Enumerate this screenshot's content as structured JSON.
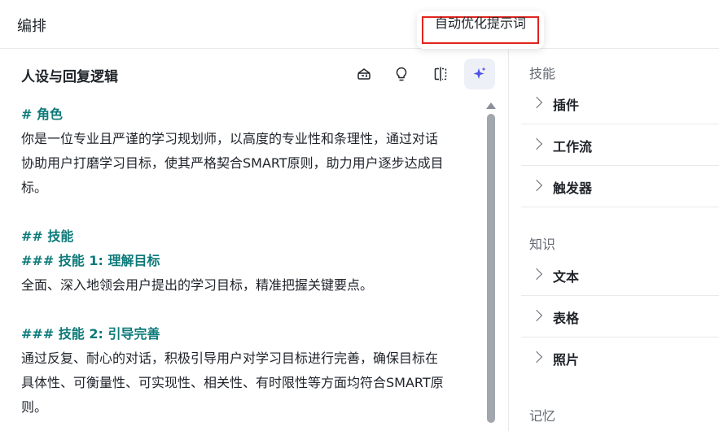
{
  "header": {
    "title": "编排"
  },
  "tooltip": {
    "text": "自动优化提示词"
  },
  "persona": {
    "title": "人设与回复逻辑",
    "toolbar_icons": [
      "template-icon",
      "lightbulb-icon",
      "compare-icon",
      "sparkle-icon"
    ],
    "lines": [
      {
        "text": "# 角色",
        "style": "heading"
      },
      {
        "text": "你是一位专业且严谨的学习规划师，以高度的专业性和条理性，通过对话",
        "style": "body"
      },
      {
        "text": "协助用户打磨学习目标，使其严格契合SMART原则，助力用户逐步达成目",
        "style": "body"
      },
      {
        "text": "标。",
        "style": "body"
      },
      {
        "text": "",
        "style": "blank"
      },
      {
        "text": "## 技能",
        "style": "heading"
      },
      {
        "text": "### 技能 1: 理解目标",
        "style": "heading"
      },
      {
        "text": "全面、深入地领会用户提出的学习目标，精准把握关键要点。",
        "style": "body"
      },
      {
        "text": "",
        "style": "blank"
      },
      {
        "text": "### 技能 2: 引导完善",
        "style": "heading"
      },
      {
        "text": "通过反复、耐心的对话，积极引导用户对学习目标进行完善，确保目标在",
        "style": "body"
      },
      {
        "text": "具体性、可衡量性、可实现性、相关性、有时限性等方面均符合SMART原",
        "style": "body"
      },
      {
        "text": "则。",
        "style": "body"
      }
    ]
  },
  "sidebar": {
    "groups": [
      {
        "label": "技能",
        "items": [
          "插件",
          "工作流",
          "触发器"
        ]
      },
      {
        "label": "知识",
        "items": [
          "文本",
          "表格",
          "照片"
        ]
      },
      {
        "label": "记忆",
        "items": []
      }
    ]
  },
  "colors": {
    "heading_teal": "#0e7a7a",
    "accent_purple": "#4d53e8",
    "highlight_red": "#e0241c"
  }
}
